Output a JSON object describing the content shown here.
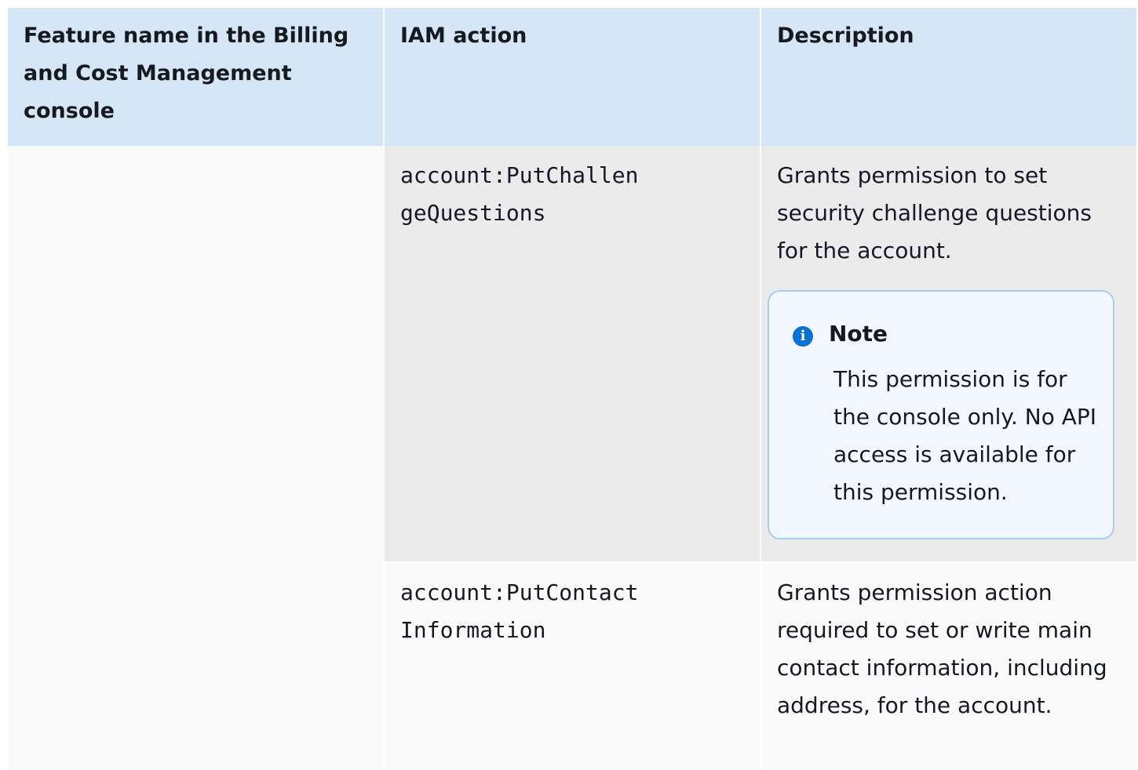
{
  "table": {
    "headers": [
      "Feature name in the Billing and Cost Management console",
      "IAM action",
      "Description"
    ],
    "rows": [
      {
        "feature": "",
        "action": "account:PutChallen\ngeQuestions",
        "description": "Grants permission to set security challenge questions for the account.",
        "note": {
          "title": "Note",
          "text": "This permission is for the console only. No API access is available for this permission."
        }
      },
      {
        "feature": "",
        "action": "account:PutContact\nInformation",
        "description": "Grants permission action required to set or write main contact information, including address, for the account."
      }
    ]
  },
  "colors": {
    "header_bg": "#d5e6f7",
    "row_alt_bg": "#ebebeb",
    "row_bg": "#fafafa",
    "note_border": "#a9cdef",
    "note_bg": "#f1f8ff",
    "info_icon": "#0972d3"
  },
  "icons": {
    "note_icon": "info-icon"
  }
}
